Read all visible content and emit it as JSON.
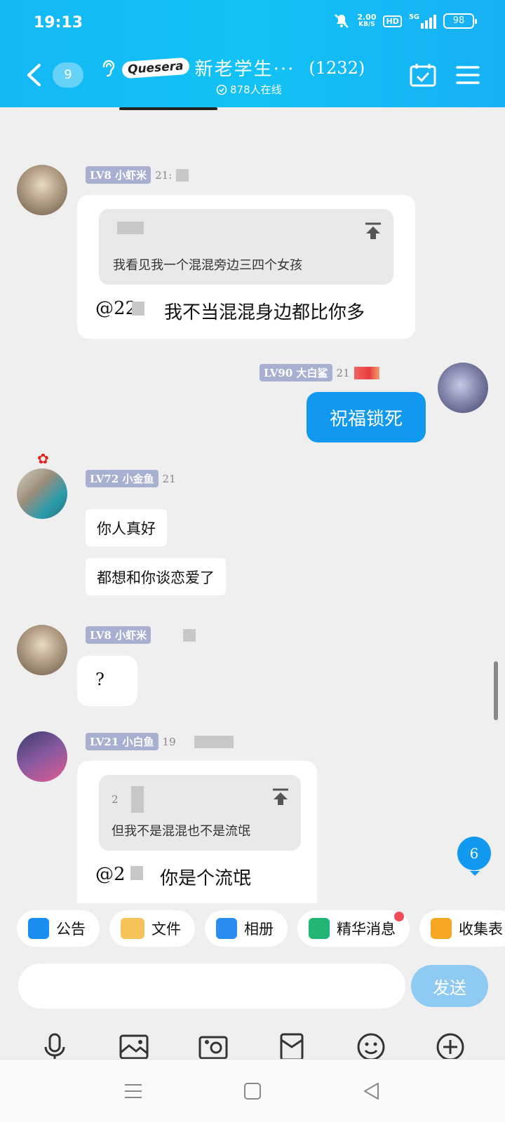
{
  "status": {
    "time": "19:13",
    "speed_value": "2.00",
    "speed_unit": "KB/S",
    "hd": "HD",
    "network": "5G",
    "battery": "98"
  },
  "header": {
    "unread_count": "9",
    "logo_text": "Quesera",
    "group_name": "新老学生···",
    "member_count": "(1232)",
    "online_text": "878人在线"
  },
  "messages": [
    {
      "level": "LV8",
      "nickname": "小虾米",
      "time": "21:",
      "quote_text": "我看见我一个混混旁边三四个女孩",
      "mention": "@22",
      "text": "我不当混混身边都比你多"
    },
    {
      "level": "LV90",
      "nickname": "大白鲨",
      "time": "21",
      "text": "祝福锁死"
    },
    {
      "level": "LV72",
      "nickname": "小金鱼",
      "time": "21",
      "lines": [
        "你人真好",
        "都想和你谈恋爱了"
      ]
    },
    {
      "level": "LV8",
      "nickname": "小虾米",
      "text": "?"
    },
    {
      "level": "LV21",
      "nickname": "小白鱼",
      "time": "19",
      "quote_author": "2",
      "quote_text": "但我不是混混也不是流氓",
      "mention": "@2",
      "text": "你是个流氓"
    }
  ],
  "new_message_count": "6",
  "shortcuts": [
    {
      "label": "公告",
      "icon": "announcement-icon",
      "color": "#1b8ff0"
    },
    {
      "label": "文件",
      "icon": "folder-icon",
      "color": "#f6b93b"
    },
    {
      "label": "相册",
      "icon": "album-icon",
      "color": "#2a8ef0"
    },
    {
      "label": "精华消息",
      "icon": "highlight-icon",
      "color": "#22b573"
    },
    {
      "label": "收集表",
      "icon": "form-icon",
      "color": "#f5a623"
    }
  ],
  "input": {
    "placeholder": "",
    "send_label": "发送"
  },
  "toolbar": [
    "microphone-icon",
    "image-icon",
    "camera-icon",
    "red-packet-icon",
    "emoji-icon",
    "plus-icon"
  ]
}
